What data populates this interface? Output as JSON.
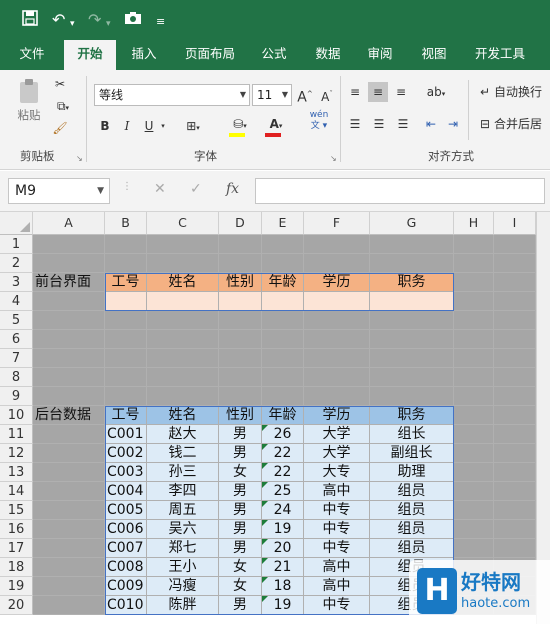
{
  "quick_access": {
    "save_icon": "save-icon",
    "undo_icon": "undo-icon",
    "redo_icon": "redo-icon",
    "camera_icon": "camera-icon",
    "customize_icon": "customize-icon"
  },
  "tabs": [
    "文件",
    "开始",
    "插入",
    "页面布局",
    "公式",
    "数据",
    "审阅",
    "视图",
    "开发工具"
  ],
  "active_tab": "开始",
  "clipboard": {
    "paste_label": "粘贴",
    "group_label": "剪贴板"
  },
  "font": {
    "name": "等线",
    "size": "11",
    "group_label": "字体",
    "bold": "B",
    "italic": "I",
    "underline": "U",
    "font_color_letter": "A",
    "font_color": "#e02020",
    "fill_color": "#ffff00",
    "wen_label": "wén\n文"
  },
  "alignment": {
    "wrap_label": "自动换行",
    "merge_label": "合并后居",
    "group_label": "对齐方式"
  },
  "formula_bar": {
    "name_box": "M9",
    "fx": "fx",
    "value": ""
  },
  "columns": [
    "A",
    "B",
    "C",
    "D",
    "E",
    "F",
    "G",
    "H",
    "I"
  ],
  "rows": [
    "1",
    "2",
    "3",
    "4",
    "5",
    "6",
    "7",
    "8",
    "9",
    "10",
    "11",
    "12",
    "13",
    "14",
    "15",
    "16",
    "17",
    "18",
    "19",
    "20"
  ],
  "front": {
    "label": "前台界面",
    "headers": [
      "工号",
      "姓名",
      "性别",
      "年龄",
      "学历",
      "职务"
    ]
  },
  "back": {
    "label": "后台数据",
    "headers": [
      "工号",
      "姓名",
      "性别",
      "年龄",
      "学历",
      "职务"
    ],
    "rows": [
      [
        "C001",
        "赵大",
        "男",
        "26",
        "大学",
        "组长"
      ],
      [
        "C002",
        "钱二",
        "男",
        "22",
        "大学",
        "副组长"
      ],
      [
        "C003",
        "孙三",
        "女",
        "22",
        "大专",
        "助理"
      ],
      [
        "C004",
        "李四",
        "男",
        "25",
        "高中",
        "组员"
      ],
      [
        "C005",
        "周五",
        "男",
        "24",
        "中专",
        "组员"
      ],
      [
        "C006",
        "吴六",
        "男",
        "19",
        "中专",
        "组员"
      ],
      [
        "C007",
        "郑七",
        "男",
        "20",
        "中专",
        "组员"
      ],
      [
        "C008",
        "王小",
        "女",
        "21",
        "高中",
        "组员"
      ],
      [
        "C009",
        "冯瘦",
        "女",
        "18",
        "高中",
        "组员"
      ],
      [
        "C010",
        "陈胖",
        "男",
        "19",
        "中专",
        "组员"
      ]
    ]
  },
  "watermark": {
    "logo": "H",
    "title": "好特网",
    "url": "haote.com"
  }
}
